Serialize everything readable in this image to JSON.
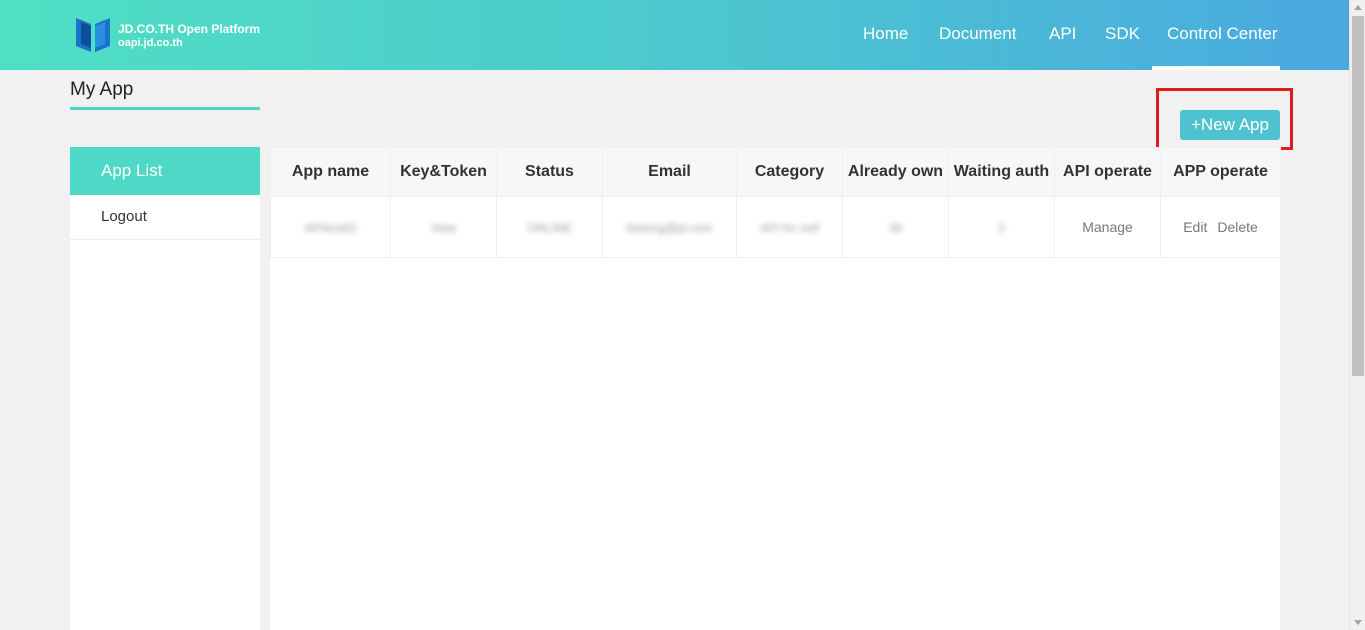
{
  "brand": {
    "title": "JD.CO.TH Open Platform",
    "subtitle": "oapi.jd.co.th",
    "accent_color": "#4dd9c6",
    "logo_icon": "open-book-logo-icon"
  },
  "nav": {
    "items": [
      {
        "label": "Home"
      },
      {
        "label": "Document"
      },
      {
        "label": "API"
      },
      {
        "label": "SDK"
      },
      {
        "label": "Control Center"
      }
    ],
    "active": "Control Center"
  },
  "page": {
    "title": "My App",
    "new_app_label": "+New App",
    "highlight_color": "#e01b1b"
  },
  "sidebar": {
    "items": [
      {
        "label": "App List",
        "active": true
      },
      {
        "label": "Logout",
        "active": false
      }
    ]
  },
  "table": {
    "headers": [
      "App name",
      "Key&Token",
      "Status",
      "Email",
      "Category",
      "Already own",
      "Waiting auth",
      "API operate",
      "APP operate"
    ],
    "rows": [
      {
        "app_name": "APItest02",
        "key_token": "View",
        "status": "ONLINE",
        "email": "fisheng@jd.com",
        "category": "API for self",
        "already_own": "30",
        "waiting_auth": "0",
        "api_operate": "Manage",
        "edit": "Edit",
        "delete": "Delete"
      }
    ]
  }
}
